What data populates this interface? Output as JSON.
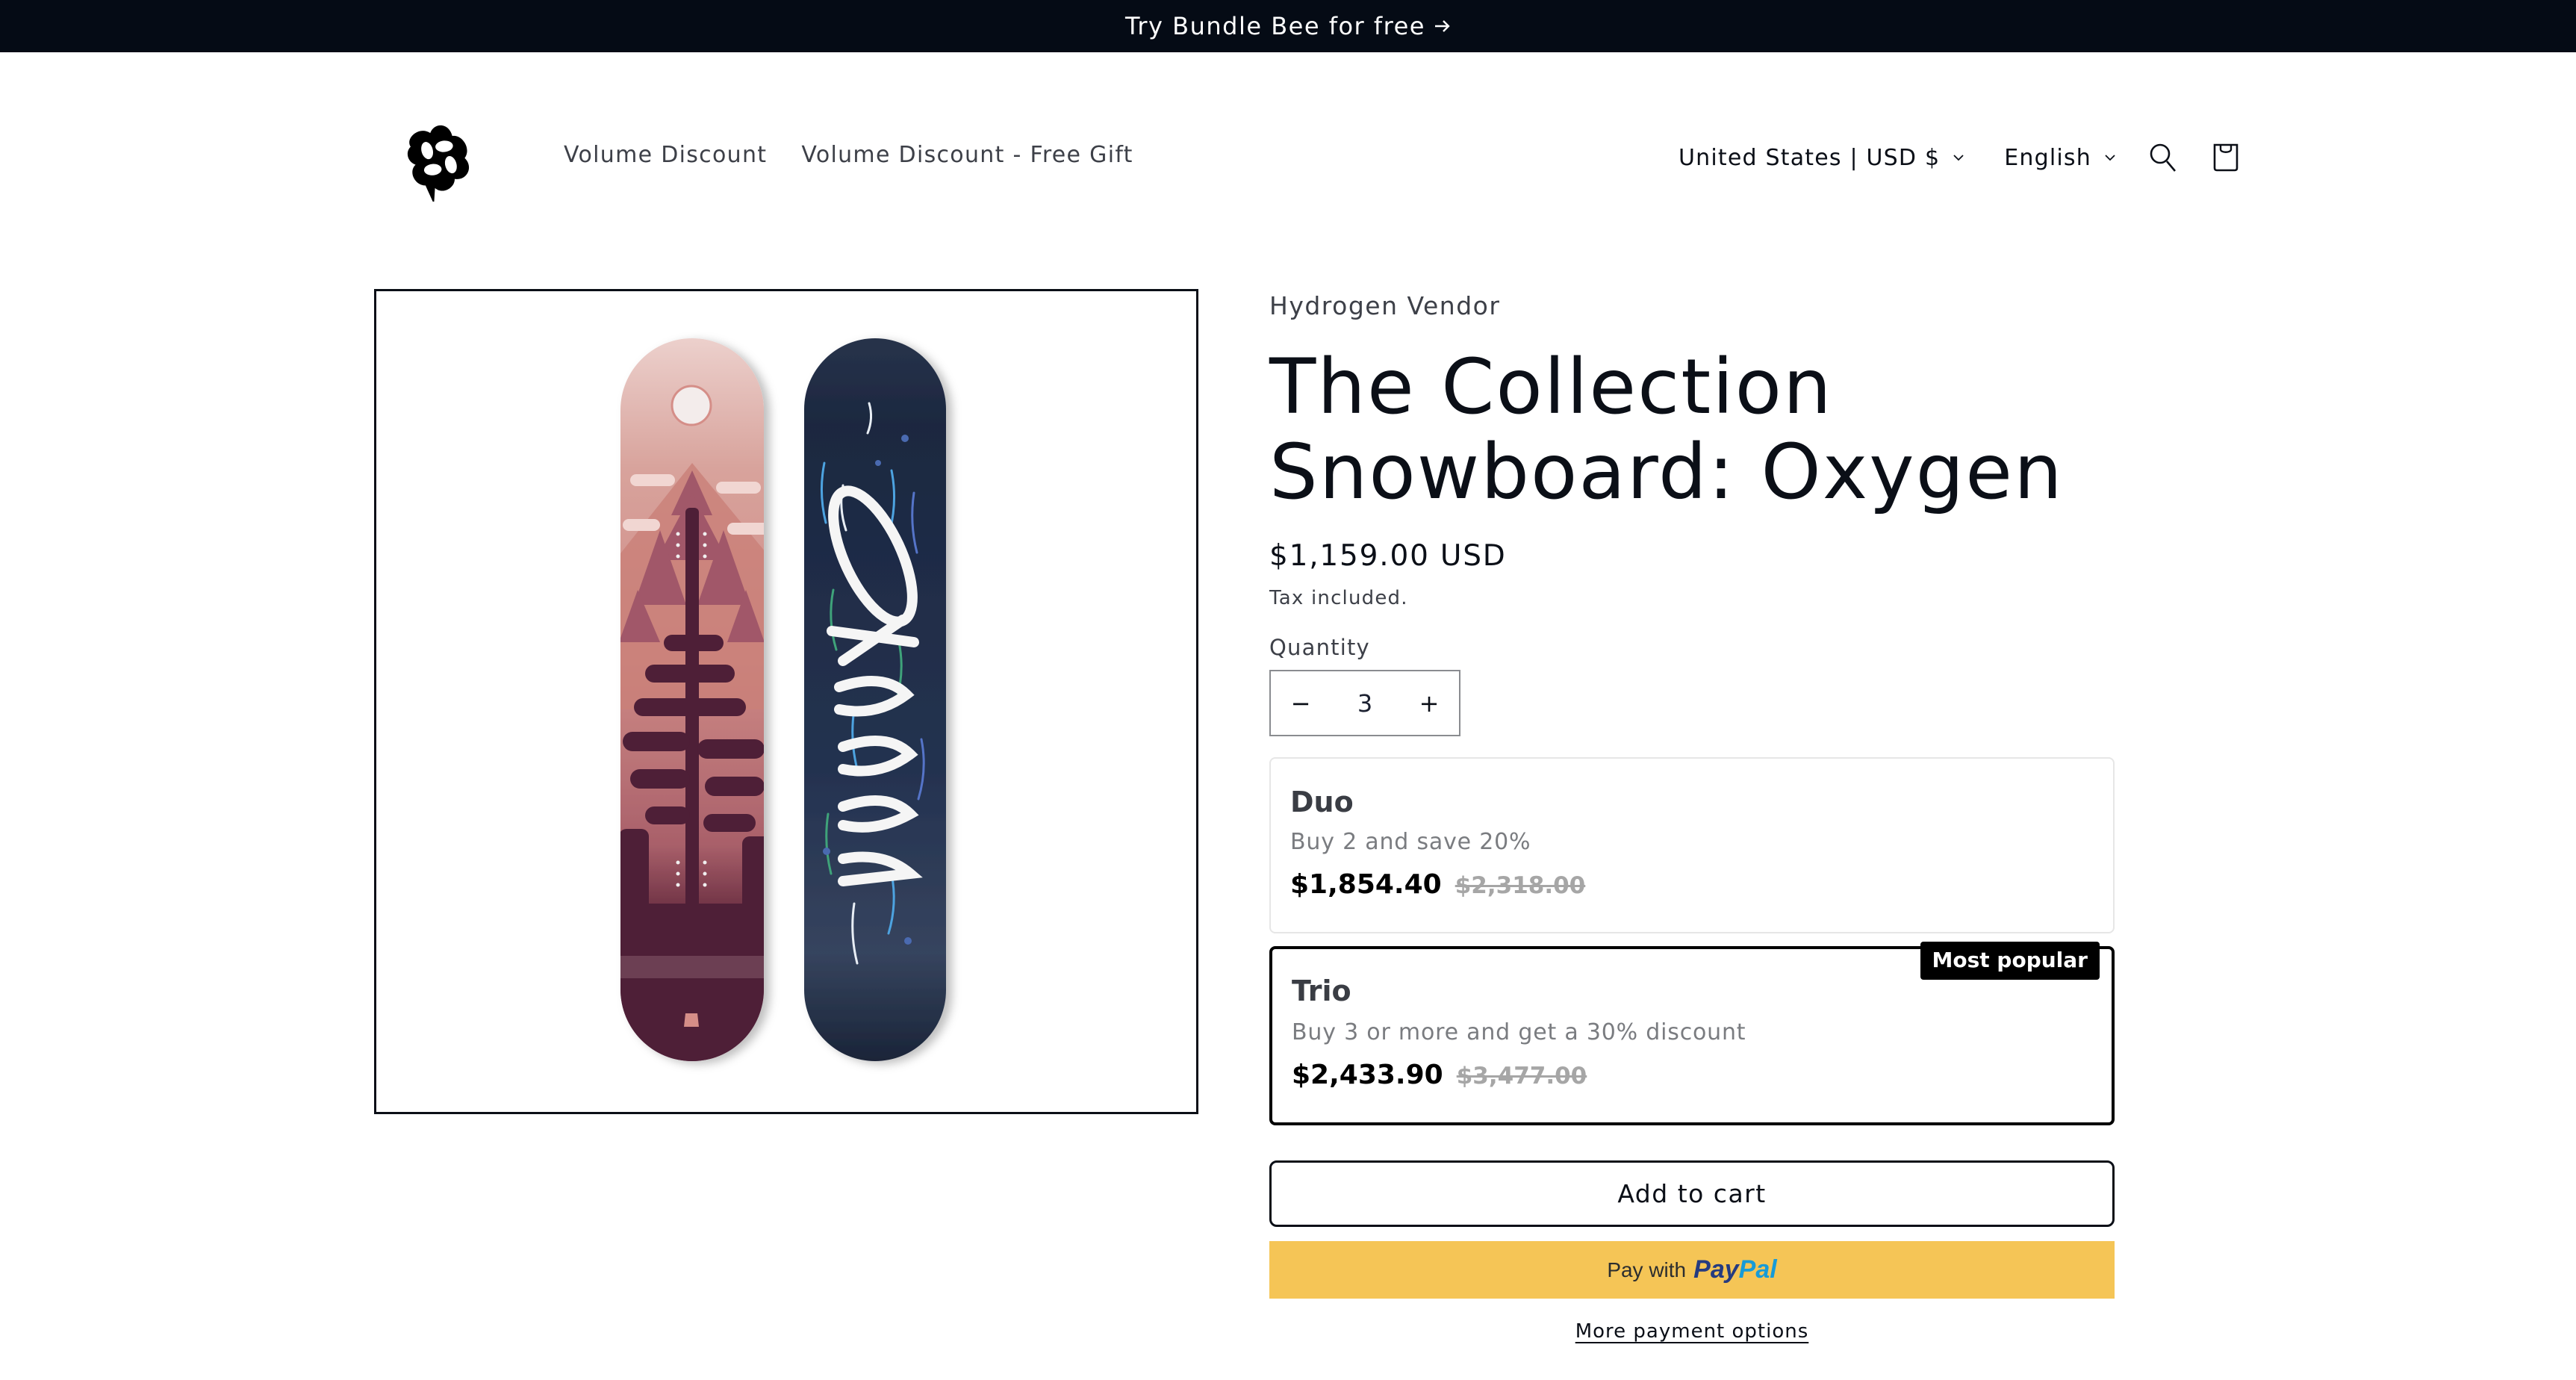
{
  "announcement": {
    "text": "Try Bundle Bee for free",
    "arrow_icon": "arrow-right-icon"
  },
  "header": {
    "logo_icon": "bundle-bee-logo",
    "nav": [
      {
        "label": "Volume Discount"
      },
      {
        "label": "Volume Discount - Free Gift"
      }
    ],
    "country_selector": {
      "value": "United States | USD $",
      "icon": "chevron-down-icon"
    },
    "language_selector": {
      "value": "English",
      "icon": "chevron-down-icon"
    },
    "search_icon": "search-icon",
    "cart_icon": "cart-bag-icon"
  },
  "product": {
    "image_alt": "The Collection Snowboard: Oxygen - two snowboards, pink forest design and navy 'Oxygen' script design",
    "vendor": "Hydrogen Vendor",
    "title": "The Collection Snowboard: Oxygen",
    "price": "$1,159.00 USD",
    "tax_note": "Tax included.",
    "quantity": {
      "label": "Quantity",
      "value": "3",
      "decrease": "−",
      "increase": "+"
    }
  },
  "bundle_tiers": [
    {
      "name": "Duo",
      "description": "Buy 2 and save 20%",
      "price": "$1,854.40",
      "compare_price": "$2,318.00",
      "selected": false,
      "badge": null
    },
    {
      "name": "Trio",
      "description": "Buy 3 or more and get a 30% discount",
      "price": "$2,433.90",
      "compare_price": "$3,477.00",
      "selected": true,
      "badge": "Most popular"
    }
  ],
  "actions": {
    "add_to_cart": "Add to cart",
    "paypal_prefix": "Pay with",
    "paypal_brand_1": "Pay",
    "paypal_brand_2": "Pal",
    "more_payment_options": "More payment options"
  },
  "colors": {
    "announcement_bg": "#050b15",
    "text": "#0b0f17",
    "paypal_bg": "#f5c556",
    "paypal_navy": "#253b80",
    "paypal_blue": "#179bd7",
    "badge_bg": "#000000",
    "strike_gray": "#a6a6a6"
  }
}
